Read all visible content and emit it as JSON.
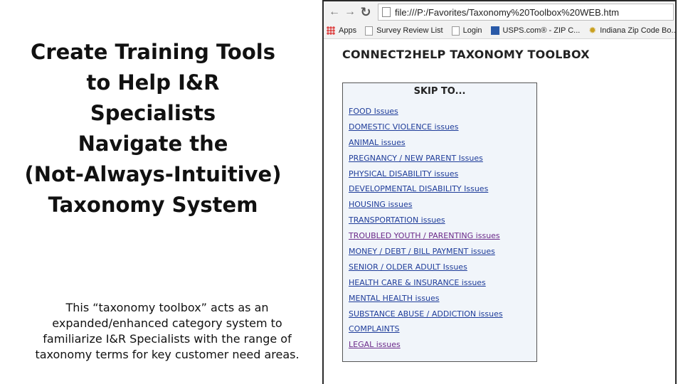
{
  "slide": {
    "title_lines": [
      "Create Training Tools",
      "to Help I&R Specialists",
      "Navigate the",
      "(Not-Always-Intuitive)",
      "Taxonomy System"
    ],
    "description_lines": [
      "This “taxonomy toolbox” acts as an",
      "expanded/enhanced category system to",
      "familiarize I&R Specialists with the range of",
      "taxonomy terms for key customer need areas."
    ]
  },
  "browser": {
    "back_icon": "arrow-left-icon",
    "forward_icon": "arrow-right-icon",
    "reload_icon": "reload-icon",
    "url": "file:///P:/Favorites/Taxonomy%20Toolbox%20WEB.htm",
    "bookmarks": [
      {
        "label": "Apps",
        "icon": "apps-grid-icon"
      },
      {
        "label": "Survey Review List",
        "icon": "page-icon"
      },
      {
        "label": "Login",
        "icon": "page-icon"
      },
      {
        "label": "USPS.com® - ZIP C...",
        "icon": "usps-icon"
      },
      {
        "label": "Indiana Zip Code Bo...",
        "icon": "sun-icon"
      }
    ]
  },
  "page": {
    "heading": "CONNECT2HELP TAXONOMY TOOLBOX",
    "skip_title": "SKIP TO...",
    "links": [
      {
        "label": "FOOD Issues",
        "visited": false
      },
      {
        "label": "DOMESTIC VIOLENCE issues",
        "visited": false
      },
      {
        "label": "ANIMAL issues",
        "visited": false
      },
      {
        "label": "PREGNANCY / NEW PARENT Issues",
        "visited": false
      },
      {
        "label": "PHYSICAL DISABILITY issues",
        "visited": false
      },
      {
        "label": "DEVELOPMENTAL DISABILITY Issues",
        "visited": false
      },
      {
        "label": "HOUSING issues",
        "visited": false
      },
      {
        "label": "TRANSPORTATION issues",
        "visited": false
      },
      {
        "label": "TROUBLED YOUTH / PARENTING issues",
        "visited": true
      },
      {
        "label": "MONEY / DEBT / BILL PAYMENT issues",
        "visited": false
      },
      {
        "label": "SENIOR / OLDER ADULT Issues",
        "visited": false
      },
      {
        "label": "HEALTH CARE & INSURANCE issues",
        "visited": false
      },
      {
        "label": "MENTAL HEALTH issues",
        "visited": false
      },
      {
        "label": "SUBSTANCE ABUSE / ADDICTION issues",
        "visited": false
      },
      {
        "label": "COMPLAINTS",
        "visited": false
      },
      {
        "label": "LEGAL issues",
        "visited": true
      }
    ]
  }
}
